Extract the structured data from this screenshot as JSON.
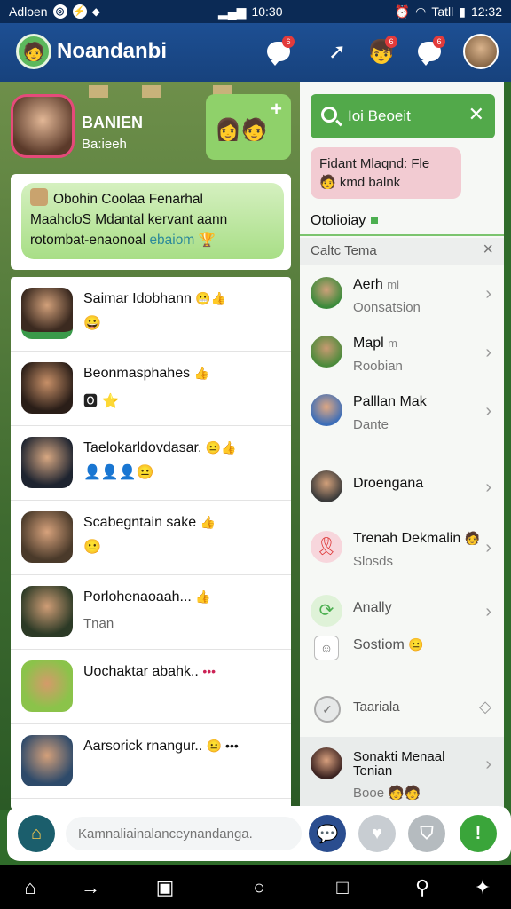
{
  "statusbar": {
    "left_text": "Adloen",
    "time": "10:30",
    "right_text": "Tatll",
    "right_time": "12:32"
  },
  "app": {
    "title": "Noandanbi",
    "badges": [
      "6",
      "6",
      "6"
    ]
  },
  "profile": {
    "name": "BANIEN",
    "sub": "Ba:ieeh"
  },
  "add_card": {
    "plus": "+"
  },
  "greeting": {
    "line1": "Obohin Coolaa Fenarhal",
    "line2": "MaahcloS Mdantal kervant aann",
    "line3": "rotombat-enaonoal",
    "link": "ebaiom"
  },
  "chats": [
    {
      "name": "Saimar Idobhann",
      "emojis": "😬👍",
      "sub_emojis": "😀"
    },
    {
      "name": "Beonmasphahes",
      "emojis": "👍",
      "sub_emojis": "🅾 ⭐"
    },
    {
      "name": "Taelokarldovdasar.",
      "emojis": "😐👍",
      "sub_emojis": "👤👤👤😐"
    },
    {
      "name": "Scabegntain sake",
      "emojis": "👍",
      "sub_emojis": "😐"
    },
    {
      "name": "Porlohenaoaah...",
      "emojis": "👍",
      "sub": "Tnan"
    },
    {
      "name": "Uochaktar abahk..",
      "emojis": "•••",
      "sub_emojis": ""
    },
    {
      "name": "Aarsorick rnangur..",
      "emojis": "😐 •••",
      "sub_emojis": ""
    }
  ],
  "right": {
    "search_text": "Ioi Beoeit",
    "note_line1": "Fidant Mlaqnd: Fle",
    "note_line2": "kmd balnk",
    "section_title": "Otolioiay",
    "subhead": "Caltc Tema",
    "contacts": [
      {
        "name": "Aerh",
        "meta": "ml",
        "sub": "Oonsatsion"
      },
      {
        "name": "Mapl",
        "meta": "m",
        "sub": "Roobian"
      },
      {
        "name": "Palllan Mak",
        "meta": "",
        "sub": "Dante"
      },
      {
        "name": "Droengana",
        "meta": "",
        "sub": ""
      },
      {
        "name": "Trenah Dekmalin",
        "meta": "",
        "sub": "Slosds"
      },
      {
        "name": "Anally",
        "meta": "",
        "sub": ""
      },
      {
        "name": "Sostiom",
        "meta": "",
        "sub": ""
      },
      {
        "name": "Taariala",
        "meta": "",
        "sub": ""
      },
      {
        "name": "Sonakti Menaal",
        "meta": "Tenian",
        "sub": "Booe"
      }
    ]
  },
  "compose": {
    "placeholder": "Kamnaliainalanceynandanga."
  },
  "colors": {
    "header": "#1d4f93",
    "accent": "#52a94a",
    "note": "#f2cbd2"
  }
}
